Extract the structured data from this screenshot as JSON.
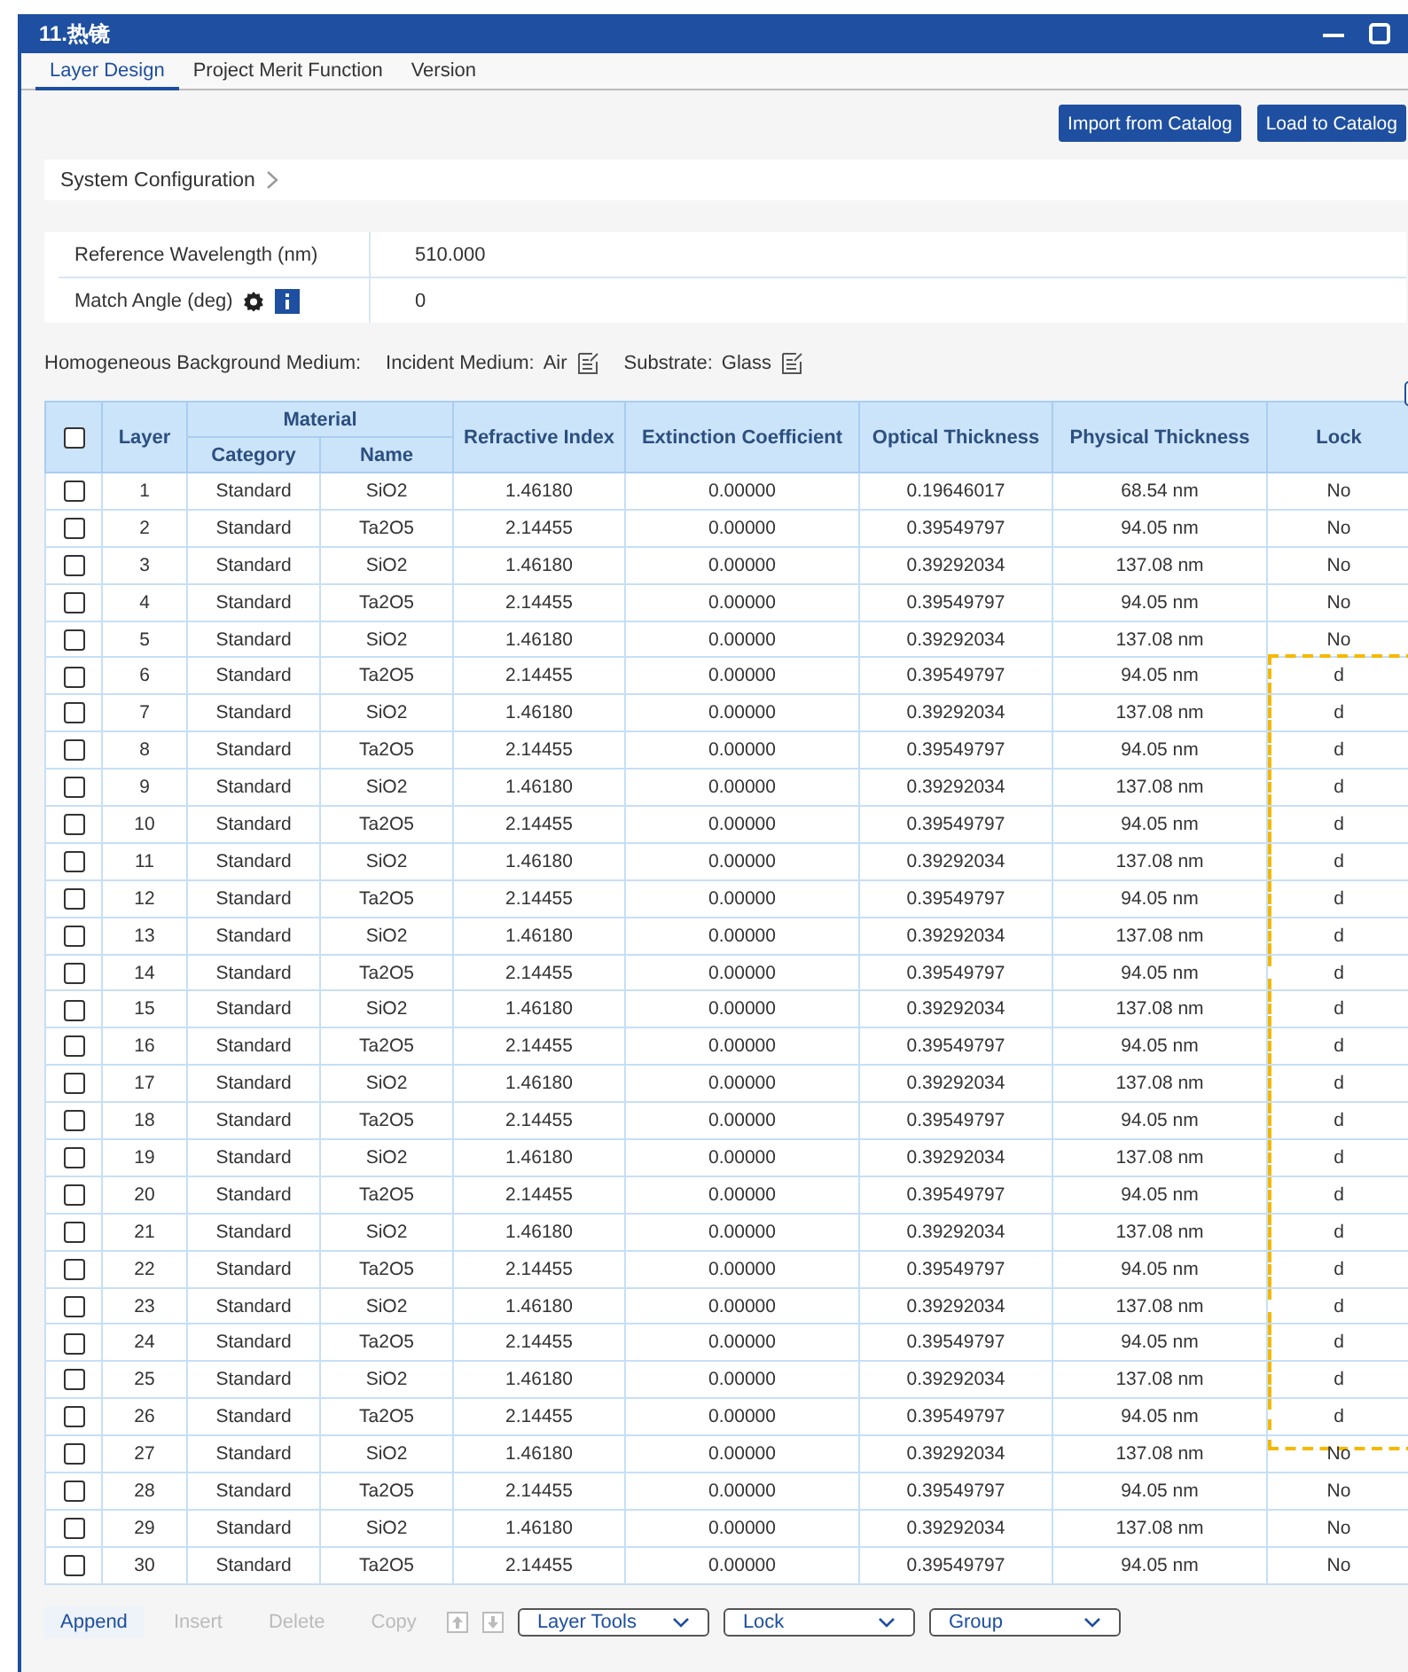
{
  "window": {
    "title": "11.热镜"
  },
  "tabs": [
    {
      "label": "Layer Design",
      "selected": true
    },
    {
      "label": "Project Merit Function",
      "selected": false
    },
    {
      "label": "Version",
      "selected": false
    }
  ],
  "buttons": [
    "Import from Catalog",
    "Load to Catalog"
  ],
  "system_configuration": {
    "label": "System Configuration",
    "expanded": false
  },
  "parameters": [
    {
      "label": "Reference Wavelength (nm)",
      "value": "510.000",
      "kind": "plain"
    },
    {
      "label": "Match Angle (deg)",
      "value": "0",
      "kind": "tools"
    }
  ],
  "background_medium": {
    "label": "Homogeneous Background Medium:",
    "incident_label": "Incident Medium:",
    "incident_value": "Air",
    "substrate_label": "Substrate:",
    "substrate_value": "Glass"
  },
  "table": {
    "select_all_checked": false,
    "columns": {
      "layer": "Layer",
      "material": "Material",
      "category": "Category",
      "name": "Name",
      "refractive_index": "Refractive Index",
      "extinction": "Extinction Coefficient",
      "optical": "Optical Thickness",
      "physical": "Physical Thickness",
      "lock": "Lock"
    },
    "rows": [
      {
        "checked": false,
        "layer": "1",
        "category": "Standard",
        "name": "SiO2",
        "refractive_index": "1.46180",
        "extinction": "0.00000",
        "optical": "0.19646017",
        "physical": "68.54 nm",
        "lock": "No",
        "lock_selected": false
      },
      {
        "checked": false,
        "layer": "2",
        "category": "Standard",
        "name": "Ta2O5",
        "refractive_index": "2.14455",
        "extinction": "0.00000",
        "optical": "0.39549797",
        "physical": "94.05 nm",
        "lock": "No",
        "lock_selected": false
      },
      {
        "checked": false,
        "layer": "3",
        "category": "Standard",
        "name": "SiO2",
        "refractive_index": "1.46180",
        "extinction": "0.00000",
        "optical": "0.39292034",
        "physical": "137.08 nm",
        "lock": "No",
        "lock_selected": false
      },
      {
        "checked": false,
        "layer": "4",
        "category": "Standard",
        "name": "Ta2O5",
        "refractive_index": "2.14455",
        "extinction": "0.00000",
        "optical": "0.39549797",
        "physical": "94.05 nm",
        "lock": "No",
        "lock_selected": false
      },
      {
        "checked": false,
        "layer": "5",
        "category": "Standard",
        "name": "SiO2",
        "refractive_index": "1.46180",
        "extinction": "0.00000",
        "optical": "0.39292034",
        "physical": "137.08 nm",
        "lock": "No",
        "lock_selected": false
      },
      {
        "checked": false,
        "layer": "6",
        "category": "Standard",
        "name": "Ta2O5",
        "refractive_index": "2.14455",
        "extinction": "0.00000",
        "optical": "0.39549797",
        "physical": "94.05 nm",
        "lock": "d",
        "lock_selected": true
      },
      {
        "checked": false,
        "layer": "7",
        "category": "Standard",
        "name": "SiO2",
        "refractive_index": "1.46180",
        "extinction": "0.00000",
        "optical": "0.39292034",
        "physical": "137.08 nm",
        "lock": "d",
        "lock_selected": true
      },
      {
        "checked": false,
        "layer": "8",
        "category": "Standard",
        "name": "Ta2O5",
        "refractive_index": "2.14455",
        "extinction": "0.00000",
        "optical": "0.39549797",
        "physical": "94.05 nm",
        "lock": "d",
        "lock_selected": true
      },
      {
        "checked": false,
        "layer": "9",
        "category": "Standard",
        "name": "SiO2",
        "refractive_index": "1.46180",
        "extinction": "0.00000",
        "optical": "0.39292034",
        "physical": "137.08 nm",
        "lock": "d",
        "lock_selected": true
      },
      {
        "checked": false,
        "layer": "10",
        "category": "Standard",
        "name": "Ta2O5",
        "refractive_index": "2.14455",
        "extinction": "0.00000",
        "optical": "0.39549797",
        "physical": "94.05 nm",
        "lock": "d",
        "lock_selected": true
      },
      {
        "checked": false,
        "layer": "11",
        "category": "Standard",
        "name": "SiO2",
        "refractive_index": "1.46180",
        "extinction": "0.00000",
        "optical": "0.39292034",
        "physical": "137.08 nm",
        "lock": "d",
        "lock_selected": true
      },
      {
        "checked": false,
        "layer": "12",
        "category": "Standard",
        "name": "Ta2O5",
        "refractive_index": "2.14455",
        "extinction": "0.00000",
        "optical": "0.39549797",
        "physical": "94.05 nm",
        "lock": "d",
        "lock_selected": true
      },
      {
        "checked": false,
        "layer": "13",
        "category": "Standard",
        "name": "SiO2",
        "refractive_index": "1.46180",
        "extinction": "0.00000",
        "optical": "0.39292034",
        "physical": "137.08 nm",
        "lock": "d",
        "lock_selected": true
      },
      {
        "checked": false,
        "layer": "14",
        "category": "Standard",
        "name": "Ta2O5",
        "refractive_index": "2.14455",
        "extinction": "0.00000",
        "optical": "0.39549797",
        "physical": "94.05 nm",
        "lock": "d",
        "lock_selected": true
      },
      {
        "checked": false,
        "layer": "15",
        "category": "Standard",
        "name": "SiO2",
        "refractive_index": "1.46180",
        "extinction": "0.00000",
        "optical": "0.39292034",
        "physical": "137.08 nm",
        "lock": "d",
        "lock_selected": true
      },
      {
        "checked": false,
        "layer": "16",
        "category": "Standard",
        "name": "Ta2O5",
        "refractive_index": "2.14455",
        "extinction": "0.00000",
        "optical": "0.39549797",
        "physical": "94.05 nm",
        "lock": "d",
        "lock_selected": true
      },
      {
        "checked": false,
        "layer": "17",
        "category": "Standard",
        "name": "SiO2",
        "refractive_index": "1.46180",
        "extinction": "0.00000",
        "optical": "0.39292034",
        "physical": "137.08 nm",
        "lock": "d",
        "lock_selected": true
      },
      {
        "checked": false,
        "layer": "18",
        "category": "Standard",
        "name": "Ta2O5",
        "refractive_index": "2.14455",
        "extinction": "0.00000",
        "optical": "0.39549797",
        "physical": "94.05 nm",
        "lock": "d",
        "lock_selected": true
      },
      {
        "checked": false,
        "layer": "19",
        "category": "Standard",
        "name": "SiO2",
        "refractive_index": "1.46180",
        "extinction": "0.00000",
        "optical": "0.39292034",
        "physical": "137.08 nm",
        "lock": "d",
        "lock_selected": true
      },
      {
        "checked": false,
        "layer": "20",
        "category": "Standard",
        "name": "Ta2O5",
        "refractive_index": "2.14455",
        "extinction": "0.00000",
        "optical": "0.39549797",
        "physical": "94.05 nm",
        "lock": "d",
        "lock_selected": true
      },
      {
        "checked": false,
        "layer": "21",
        "category": "Standard",
        "name": "SiO2",
        "refractive_index": "1.46180",
        "extinction": "0.00000",
        "optical": "0.39292034",
        "physical": "137.08 nm",
        "lock": "d",
        "lock_selected": true
      },
      {
        "checked": false,
        "layer": "22",
        "category": "Standard",
        "name": "Ta2O5",
        "refractive_index": "2.14455",
        "extinction": "0.00000",
        "optical": "0.39549797",
        "physical": "94.05 nm",
        "lock": "d",
        "lock_selected": true
      },
      {
        "checked": false,
        "layer": "23",
        "category": "Standard",
        "name": "SiO2",
        "refractive_index": "1.46180",
        "extinction": "0.00000",
        "optical": "0.39292034",
        "physical": "137.08 nm",
        "lock": "d",
        "lock_selected": true
      },
      {
        "checked": false,
        "layer": "24",
        "category": "Standard",
        "name": "Ta2O5",
        "refractive_index": "2.14455",
        "extinction": "0.00000",
        "optical": "0.39549797",
        "physical": "94.05 nm",
        "lock": "d",
        "lock_selected": true
      },
      {
        "checked": false,
        "layer": "25",
        "category": "Standard",
        "name": "SiO2",
        "refractive_index": "1.46180",
        "extinction": "0.00000",
        "optical": "0.39292034",
        "physical": "137.08 nm",
        "lock": "d",
        "lock_selected": true
      },
      {
        "checked": false,
        "layer": "26",
        "category": "Standard",
        "name": "Ta2O5",
        "refractive_index": "2.14455",
        "extinction": "0.00000",
        "optical": "0.39549797",
        "physical": "94.05 nm",
        "lock": "d",
        "lock_selected": true
      },
      {
        "checked": false,
        "layer": "27",
        "category": "Standard",
        "name": "SiO2",
        "refractive_index": "1.46180",
        "extinction": "0.00000",
        "optical": "0.39292034",
        "physical": "137.08 nm",
        "lock": "No",
        "lock_selected": false
      },
      {
        "checked": false,
        "layer": "28",
        "category": "Standard",
        "name": "Ta2O5",
        "refractive_index": "2.14455",
        "extinction": "0.00000",
        "optical": "0.39549797",
        "physical": "94.05 nm",
        "lock": "No",
        "lock_selected": false
      },
      {
        "checked": false,
        "layer": "29",
        "category": "Standard",
        "name": "SiO2",
        "refractive_index": "1.46180",
        "extinction": "0.00000",
        "optical": "0.39292034",
        "physical": "137.08 nm",
        "lock": "No",
        "lock_selected": false
      },
      {
        "checked": false,
        "layer": "30",
        "category": "Standard",
        "name": "Ta2O5",
        "refractive_index": "2.14455",
        "extinction": "0.00000",
        "optical": "0.39549797",
        "physical": "94.05 nm",
        "lock": "No",
        "lock_selected": false
      }
    ]
  },
  "toolbar": {
    "actions": [
      {
        "label": "Append",
        "disabled": false
      },
      {
        "label": "Insert",
        "disabled": true
      },
      {
        "label": "Delete",
        "disabled": true
      },
      {
        "label": "Copy",
        "disabled": true
      }
    ],
    "dropdowns": [
      "Layer Tools",
      "Lock",
      "Group"
    ]
  }
}
